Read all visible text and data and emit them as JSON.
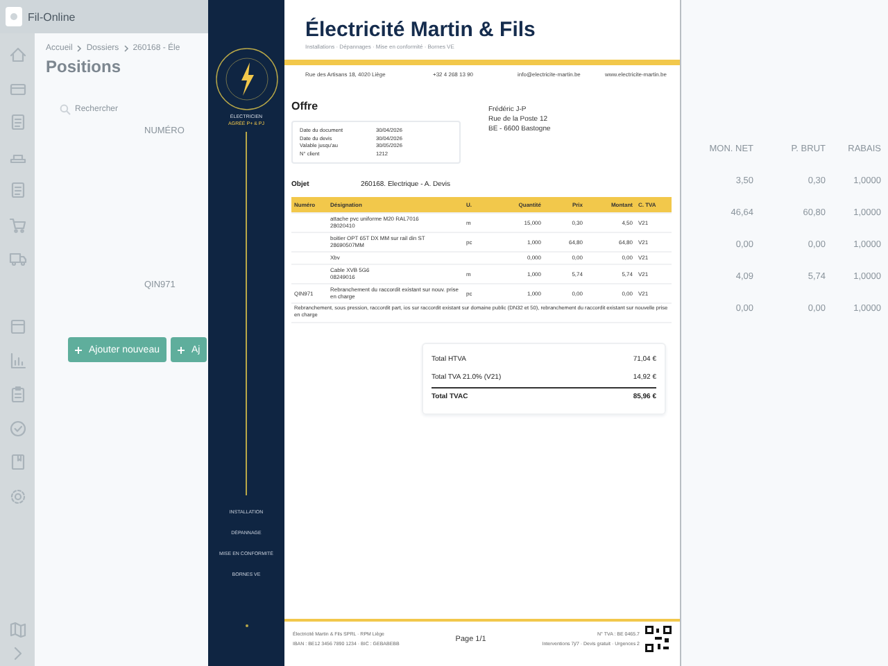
{
  "app": {
    "logo_text": "Fil-Online",
    "breadcrumb": [
      "Accueil",
      "Dossiers",
      "260168 - Éle"
    ],
    "page_title": "Positions",
    "search": {
      "placeholder": "Rechercher"
    },
    "table": {
      "columns": [
        "NUMÉRO",
        "MON. NET",
        "P. BRUT",
        "RABAIS"
      ],
      "rows": [
        {
          "mon_net": "3,50",
          "p_brut": "0,30",
          "rabais": "1,0000"
        },
        {
          "mon_net": "46,64",
          "p_brut": "60,80",
          "rabais": "1,0000"
        },
        {
          "mon_net": "0,00",
          "p_brut": "0,00",
          "rabais": "1,0000"
        },
        {
          "mon_net": "4,09",
          "p_brut": "5,74",
          "rabais": "1,0000"
        },
        {
          "numero": "QIN971",
          "mon_net": "0,00",
          "p_brut": "0,00",
          "rabais": "1,0000"
        }
      ]
    },
    "buttons": [
      "Ajouter nouveau",
      "Aj"
    ]
  },
  "document": {
    "company": "Électricité Martin & Fils",
    "tagline": "Installations · Dépannages · Mise en conformité · Bornes VE",
    "contacts": [
      "Rue des Artisans 18, 4020 Liège",
      "+32 4 268 13 90",
      "info@electricite-martin.be",
      "www.electricite-martin.be"
    ],
    "badge": [
      "ÉLECTRICIEN",
      "AGRÉÉ P+ & PJ"
    ],
    "services": [
      "INSTALLATION",
      "DÉPANNAGE",
      "MISE EN CONFORMITÉ",
      "BORNES VE"
    ],
    "doc_title": "Offre",
    "info": [
      {
        "label": "Date du document",
        "value": "30/04/2026"
      },
      {
        "label": "Date du devis",
        "value": "30/04/2026"
      },
      {
        "label": "Valable jusqu'au",
        "value": "30/05/2026"
      },
      {
        "label": "N° client",
        "value": "1212"
      }
    ],
    "client": [
      "Frédéric J-P",
      "Rue de la Poste 12",
      "BE - 6600 Bastogne"
    ],
    "object_label": "Objet",
    "object": "260168. Electrique - A. Devis",
    "columns": [
      "Numéro",
      "Désignation",
      "U.",
      "Quantité",
      "Prix",
      "Montant",
      "C. TVA"
    ],
    "lines": [
      {
        "designation": "attache pvc uniforme M20 RAL7016",
        "code": "28020410",
        "unit": "m",
        "qty": "15,000",
        "price": "0,30",
        "amount": "4,50",
        "vat": "V21"
      },
      {
        "designation": "boitier OPT 65T DX MM sur rail din ST",
        "code": "28690507MM",
        "unit": "pc",
        "qty": "1,000",
        "price": "64,80",
        "amount": "64,80",
        "vat": "V21"
      },
      {
        "designation": "Xbv",
        "qty": "0,000",
        "price": "0,00",
        "amount": "0,00",
        "vat": "V21"
      },
      {
        "designation": "Cable XVB 5G6",
        "code": "08249016",
        "unit": "m",
        "qty": "1,000",
        "price": "5,74",
        "amount": "5,74",
        "vat": "V21"
      },
      {
        "number": "QIN971",
        "designation": "Rebranchement du raccordit existant sur nouv. prise en charge",
        "unit": "pc",
        "qty": "1,000",
        "price": "0,00",
        "amount": "0,00",
        "vat": "V21",
        "note": "Rebranchement, sous pression, raccordit part, ios sur raccordit existant sur domaine public (DN32 et 50), rebranchement du raccordit existant sur nouvelle prise en charge"
      }
    ],
    "totals": [
      {
        "label": "Total HTVA",
        "value": "71,04 €",
        "bold": false
      },
      {
        "label": "Total TVA 21.0% (V21)",
        "value": "14,92 €",
        "bold": false
      },
      {
        "label": "Total TVAC",
        "value": "85,96 €",
        "bold": true
      }
    ],
    "footer_left": [
      "Électricité Martin & Fils SPRL · RPM Liège",
      "IBAN : BE12 3456 7890 1234 · BIC : GEBABEBB"
    ],
    "page": "Page 1/1",
    "footer_right": [
      "N° TVA : BE 0465.7",
      "Interventions 7j/7 · Devis gratuit · Urgences 2"
    ]
  }
}
